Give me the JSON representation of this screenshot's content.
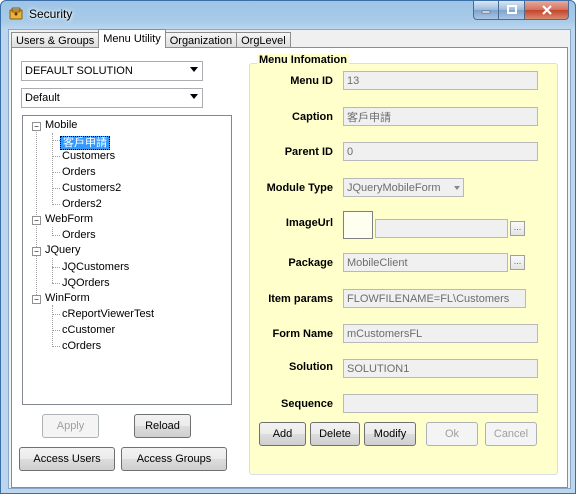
{
  "window": {
    "title": "Security",
    "icon": "key-app-icon",
    "controls": [
      "minimize-icon",
      "maximize-icon",
      "close-icon"
    ]
  },
  "tabs": [
    {
      "label": "Users & Groups",
      "active": false
    },
    {
      "label": "Menu Utility",
      "active": true
    },
    {
      "label": "Organization",
      "active": false
    },
    {
      "label": "OrgLevel",
      "active": false
    }
  ],
  "left": {
    "solution_value": "DEFAULT SOLUTION",
    "menu_value": "Default",
    "tree": {
      "mobile": "Mobile",
      "mobile_items": [
        "客戶申請",
        "Customers",
        "Orders",
        "Customers2",
        "Orders2"
      ],
      "webform": "WebForm",
      "webform_items": [
        "Orders"
      ],
      "jquery": "JQuery",
      "jquery_items": [
        "JQCustomers",
        "JQOrders"
      ],
      "winform": "WinForm",
      "winform_items": [
        "cReportViewerTest",
        "cCustomer",
        "cOrders"
      ],
      "selected": "客戶申請"
    },
    "apply_label": "Apply",
    "reload_label": "Reload",
    "access_users_label": "Access Users",
    "access_groups_label": "Access Groups"
  },
  "menu_info": {
    "title": "Menu Infomation",
    "labels": {
      "menu_id": "Menu ID",
      "caption": "Caption",
      "parent_id": "Parent ID",
      "module_type": "Module Type",
      "image_url": "ImageUrl",
      "package": "Package",
      "item_params": "Item params",
      "form_name": "Form Name",
      "solution": "Solution",
      "sequence": "Sequence"
    },
    "values": {
      "menu_id": "13",
      "caption": "客戶申請",
      "parent_id": "0",
      "module_type": "JQueryMobileForm",
      "image_url": "",
      "package": "MobileClient",
      "item_params": "FLOWFILENAME=FL\\Customers",
      "form_name": "mCustomersFL",
      "solution": "SOLUTION1",
      "sequence": ""
    },
    "ellipsis": "...",
    "buttons": {
      "add": "Add",
      "delete": "Delete",
      "modify": "Modify",
      "ok": "Ok",
      "cancel": "Cancel"
    }
  },
  "colors": {
    "group_background": "#ffffcc",
    "selection": "#3399ff",
    "disabled_text": "#a0a0a0",
    "window_frame": "#a8cbe8"
  }
}
